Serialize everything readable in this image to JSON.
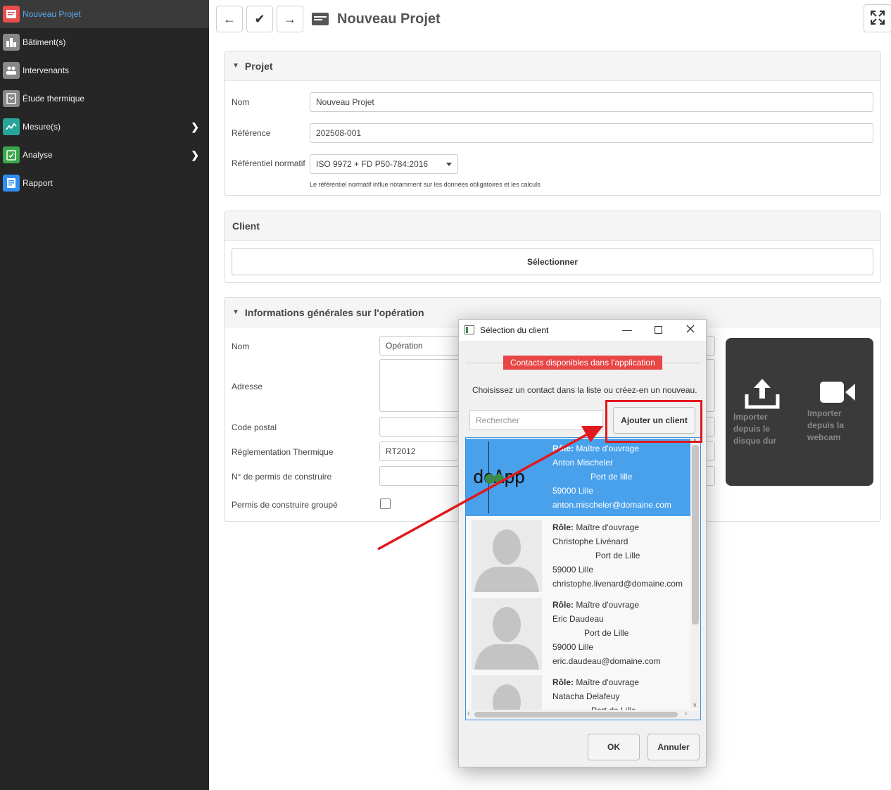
{
  "sidebar": {
    "items": [
      {
        "label": "Nouveau Projet",
        "color": "#e84e4e"
      },
      {
        "label": "Bâtiment(s)",
        "color": "#888888"
      },
      {
        "label": "Intervenants",
        "color": "#888888"
      },
      {
        "label": "Étude thermique",
        "color": "#888888"
      },
      {
        "label": "Mesure(s)",
        "color": "#26a69a"
      },
      {
        "label": "Analyse",
        "color": "#3aa84a"
      },
      {
        "label": "Rapport",
        "color": "#2f8ef0"
      }
    ]
  },
  "header": {
    "title": "Nouveau Projet"
  },
  "projet": {
    "heading": "Projet",
    "nom_label": "Nom",
    "nom_value": "Nouveau Projet",
    "ref_label": "Référence",
    "ref_value": "202508-001",
    "norm_label": "Référentiel normatif",
    "norm_value": "ISO 9972 + FD P50-784:2016",
    "norm_hint": "Le référentiel normatif influe notamment sur les données obligatoires et les calculs"
  },
  "client": {
    "heading": "Client",
    "select_label": "Sélectionner"
  },
  "operation": {
    "heading": "Informations générales sur l'opération",
    "nom_label": "Nom",
    "nom_value": "Opération",
    "adresse_label": "Adresse",
    "cp_label": "Code postal",
    "reglementation_label": "Réglementation Thermique",
    "reglementation_value": "RT2012",
    "permis_label": "N° de permis de construire",
    "permis_groupe_label": "Permis de construire groupé",
    "import_disk": [
      "Importer",
      "depuis le",
      "disque dur"
    ],
    "import_webcam": [
      "Importer",
      "depuis la",
      "webcam"
    ]
  },
  "dialog": {
    "title": "Sélection du client",
    "section": "Contacts disponibles dans l'application",
    "info": "Choisissez un contact dans la liste ou créez-en un nouveau.",
    "search_placeholder": "Rechercher",
    "add_label": "Ajouter un client",
    "ok_label": "OK",
    "cancel_label": "Annuler",
    "role_label": "Rôle:",
    "logo_text": "doApp",
    "contacts": [
      {
        "role": "Maître d'ouvrage",
        "name": "Anton Mischeler",
        "address": "Port de lille",
        "city": "59000  Lille",
        "email": "anton.mischeler@domaine.com"
      },
      {
        "role": "Maître d'ouvrage",
        "name": "Christophe Livénard",
        "address": "Port de Lille",
        "city": "59000  Lille",
        "email": "christophe.livenard@domaine.com"
      },
      {
        "role": "Maître d'ouvrage",
        "name": "Eric Daudeau",
        "address": "Port de Lille",
        "city": "59000  Lille",
        "email": "eric.daudeau@domaine.com"
      },
      {
        "role": "Maître d'ouvrage",
        "name": "Natacha Delafeuy",
        "address": "Port de Lille"
      }
    ]
  },
  "colors": {
    "accent": "#49a1ec",
    "highlight": "#e0191c",
    "section_badge": "#e84545"
  }
}
